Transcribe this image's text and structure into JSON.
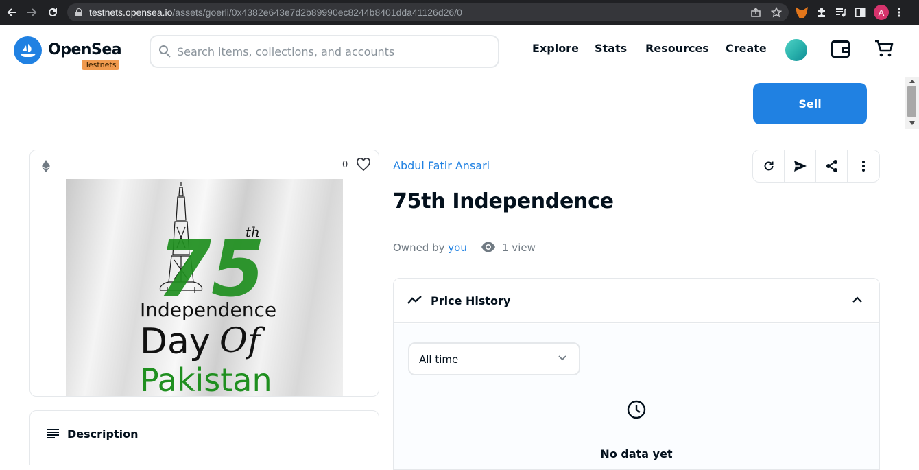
{
  "browser": {
    "url_host": "testnets.opensea.io",
    "url_path": "/assets/goerli/0x4382e643e7d2b89990ec8244b8401dda41126d26/0",
    "profile_initial": "A",
    "profile_color": "#d6336c"
  },
  "header": {
    "brand": "OpenSea",
    "badge": "Testnets",
    "search_placeholder": "Search items, collections, and accounts",
    "nav": [
      "Explore",
      "Stats",
      "Resources",
      "Create"
    ],
    "accent": "#2081e2"
  },
  "sell_button": "Sell",
  "item": {
    "favorite_count": "0",
    "image_text": {
      "number": "75",
      "suffix": "th",
      "line1": "Independence",
      "line2a": "Day",
      "line2b": "Of",
      "line3": "Pakistan"
    },
    "collection": "Abdul Fatir Ansari",
    "title": "75th Independence",
    "owned_by_label": "Owned by",
    "owner": "you",
    "views": "1 view"
  },
  "description": {
    "title": "Description"
  },
  "price_history": {
    "title": "Price History",
    "time_filter": "All time",
    "empty_text": "No data yet"
  },
  "icons": {
    "favorite": "heart-icon",
    "chain": "ethereum-icon",
    "actions": [
      "refresh-icon",
      "transfer-icon",
      "share-icon",
      "more-icon"
    ]
  }
}
